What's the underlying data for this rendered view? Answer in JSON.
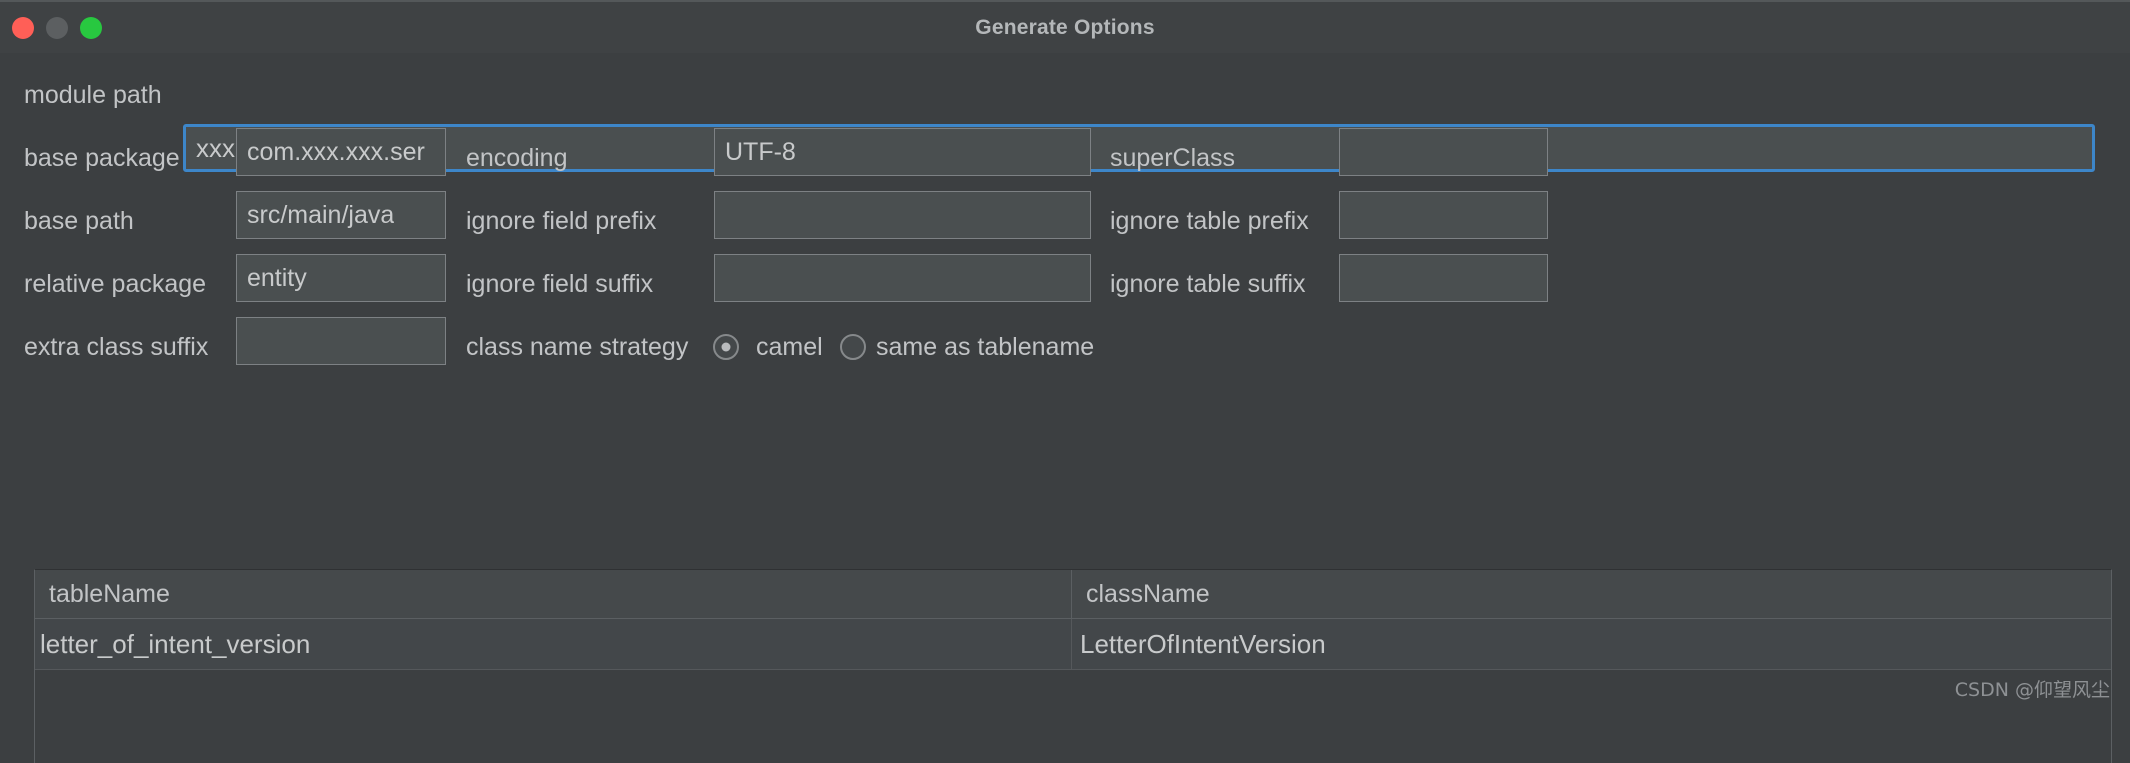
{
  "window": {
    "title": "Generate Options",
    "traffic_lights": [
      {
        "name": "close",
        "color": "#ff5f57"
      },
      {
        "name": "minimize",
        "color": "#5c5f61"
      },
      {
        "name": "zoom",
        "color": "#28c840"
      }
    ]
  },
  "form": {
    "module_path": {
      "label": "module path",
      "value": "xxx",
      "placeholder": "",
      "focused": true
    },
    "base_package": {
      "label": "base package",
      "value": "com.xxx.xxx.ser",
      "value_full": "com.xxx.xxx.service",
      "placeholder": ""
    },
    "encoding": {
      "label": "encoding",
      "value": "UTF-8",
      "placeholder": ""
    },
    "super_class": {
      "label": "superClass",
      "value": "",
      "placeholder": ""
    },
    "base_path": {
      "label": "base path",
      "value": "src/main/java",
      "placeholder": ""
    },
    "ignore_field_prefix": {
      "label": "ignore field prefix",
      "value": "",
      "placeholder": ""
    },
    "ignore_table_prefix": {
      "label": "ignore table prefix",
      "value": "",
      "placeholder": ""
    },
    "relative_package": {
      "label": "relative package",
      "value": "entity",
      "placeholder": ""
    },
    "ignore_field_suffix": {
      "label": "ignore field suffix",
      "value": "",
      "placeholder": ""
    },
    "ignore_table_suffix": {
      "label": "ignore table suffix",
      "value": "",
      "placeholder": ""
    },
    "extra_class_suffix": {
      "label": "extra class suffix",
      "value": "",
      "placeholder": ""
    },
    "class_name_strategy": {
      "label": "class name strategy",
      "options": [
        {
          "label": "camel",
          "selected": true
        },
        {
          "label": "same as tablename",
          "selected": false
        }
      ]
    }
  },
  "table": {
    "columns": [
      "tableName",
      "className"
    ],
    "rows": [
      [
        "letter_of_intent_version",
        "LetterOfIntentVersion"
      ]
    ]
  },
  "watermark": "CSDN @仰望风尘",
  "colors": {
    "window_bg": "#3c3f41",
    "field_bg": "#4a4f50",
    "field_border": "#7d8184",
    "focus_border": "#3d86c9",
    "text": "#c2c4c6"
  }
}
